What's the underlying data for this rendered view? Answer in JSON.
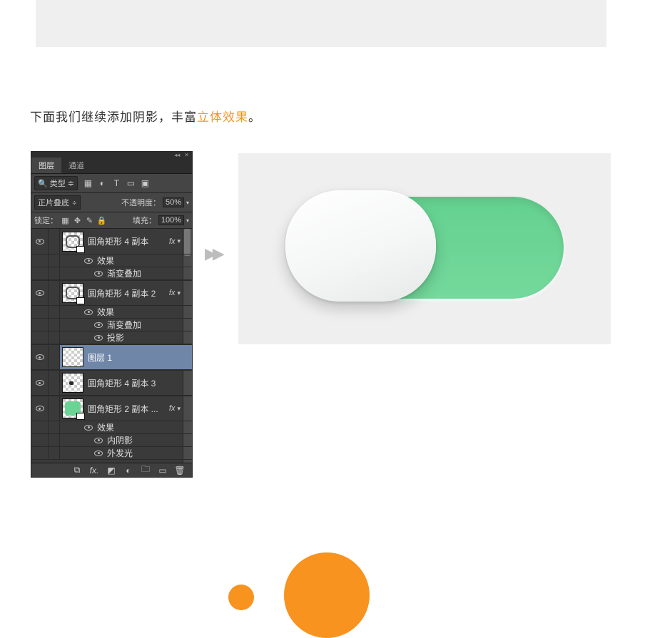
{
  "body_text": {
    "p1": "下面我们继续添加阴影，丰富",
    "accent": "立体效果",
    "p2": "。"
  },
  "panel": {
    "tabs": {
      "layers": "图层",
      "channels": "通道"
    },
    "filter_label": "类型",
    "blend_mode": "正片叠底",
    "opacity_label": "不透明度：",
    "opacity_value": "50%",
    "lock_label": "锁定：",
    "fill_label": "填充：",
    "fill_value": "100%"
  },
  "layers": [
    {
      "name": "圆角矩形 4 副本",
      "fx": true,
      "effects": [
        "效果",
        "渐变叠加"
      ]
    },
    {
      "name": "圆角矩形 4 副本 2",
      "fx": true,
      "effects": [
        "效果",
        "渐变叠加",
        "投影"
      ]
    },
    {
      "name": "图层 1",
      "selected": true
    },
    {
      "name": "圆角矩形 4 副本 3",
      "thumb": "dot"
    },
    {
      "name": "圆角矩形 2 副本 ...",
      "fx": true,
      "thumb": "green",
      "effects": [
        "效果",
        "内阴影",
        "外发光"
      ]
    }
  ],
  "fx_label": "fx",
  "icons": {
    "image": "▦",
    "adjust": "◐",
    "type": "T",
    "shape": "▭",
    "smart": "▣",
    "pixel": "▦",
    "move": "✥",
    "brush": "✎",
    "lock": "🔒",
    "link": "⧉",
    "fxMenu": "fx.",
    "mask": "◩",
    "fill": "◐",
    "group": "🗀",
    "new": "▭",
    "trash": "🗑"
  }
}
